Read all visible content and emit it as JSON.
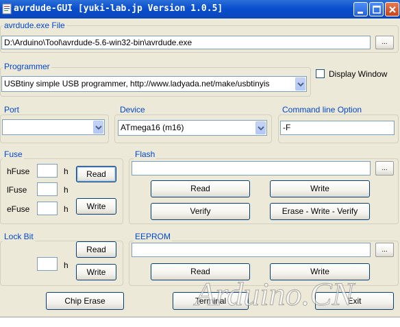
{
  "window": {
    "title": "avrdude-GUI [yuki-lab.jp Version 1.0.5]"
  },
  "avrdude_exe": {
    "group_label": "avrdude.exe File",
    "path": "D:\\Arduino\\Tool\\avrdude-5.6-win32-bin\\avrdude.exe",
    "browse_label": "..."
  },
  "programmer": {
    "group_label": "Programmer",
    "selected": "USBtiny simple USB programmer, http://www.ladyada.net/make/usbtinyis",
    "display_window_label": "Display Window",
    "display_window_checked": false
  },
  "port": {
    "group_label": "Port",
    "selected": ""
  },
  "device": {
    "group_label": "Device",
    "selected": "ATmega16 (m16)"
  },
  "command_line": {
    "group_label": "Command line Option",
    "value": "-F"
  },
  "fuse": {
    "group_label": "Fuse",
    "hfuse_label": "hFuse",
    "lfuse_label": "lFuse",
    "efuse_label": "eFuse",
    "unit": "h",
    "hfuse_value": "",
    "lfuse_value": "",
    "efuse_value": "",
    "read_label": "Read",
    "write_label": "Write"
  },
  "flash": {
    "group_label": "Flash",
    "path": "",
    "browse_label": "...",
    "read_label": "Read",
    "write_label": "Write",
    "verify_label": "Verify",
    "erase_write_verify_label": "Erase - Write - Verify"
  },
  "lock_bit": {
    "group_label": "Lock Bit",
    "value": "",
    "unit": "h",
    "read_label": "Read",
    "write_label": "Write"
  },
  "eeprom": {
    "group_label": "EEPROM",
    "path": "",
    "browse_label": "...",
    "read_label": "Read",
    "write_label": "Write"
  },
  "bottom": {
    "chip_erase_label": "Chip Erase",
    "terminal_label": "Terminal",
    "exit_label": "Exit"
  },
  "watermark": "Arduino.CN"
}
